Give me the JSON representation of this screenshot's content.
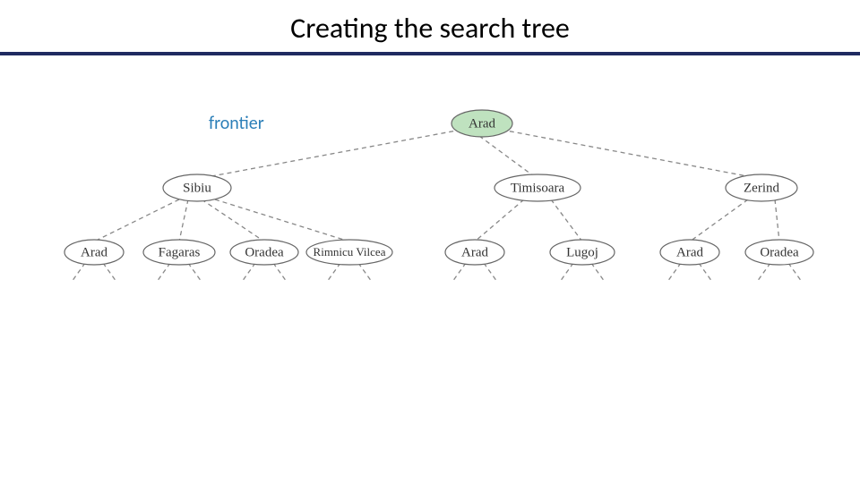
{
  "title": "Creating the search tree",
  "labels": {
    "frontier": "frontier"
  },
  "tree": {
    "root": "Arad",
    "level1": [
      "Sibiu",
      "Timisoara",
      "Zerind"
    ],
    "level2": [
      "Arad",
      "Fagaras",
      "Oradea",
      "Rimnicu Vilcea",
      "Arad",
      "Lugoj",
      "Arad",
      "Oradea"
    ],
    "colors": {
      "filled_node": "#bfe2bf",
      "edge": "#888888"
    }
  }
}
